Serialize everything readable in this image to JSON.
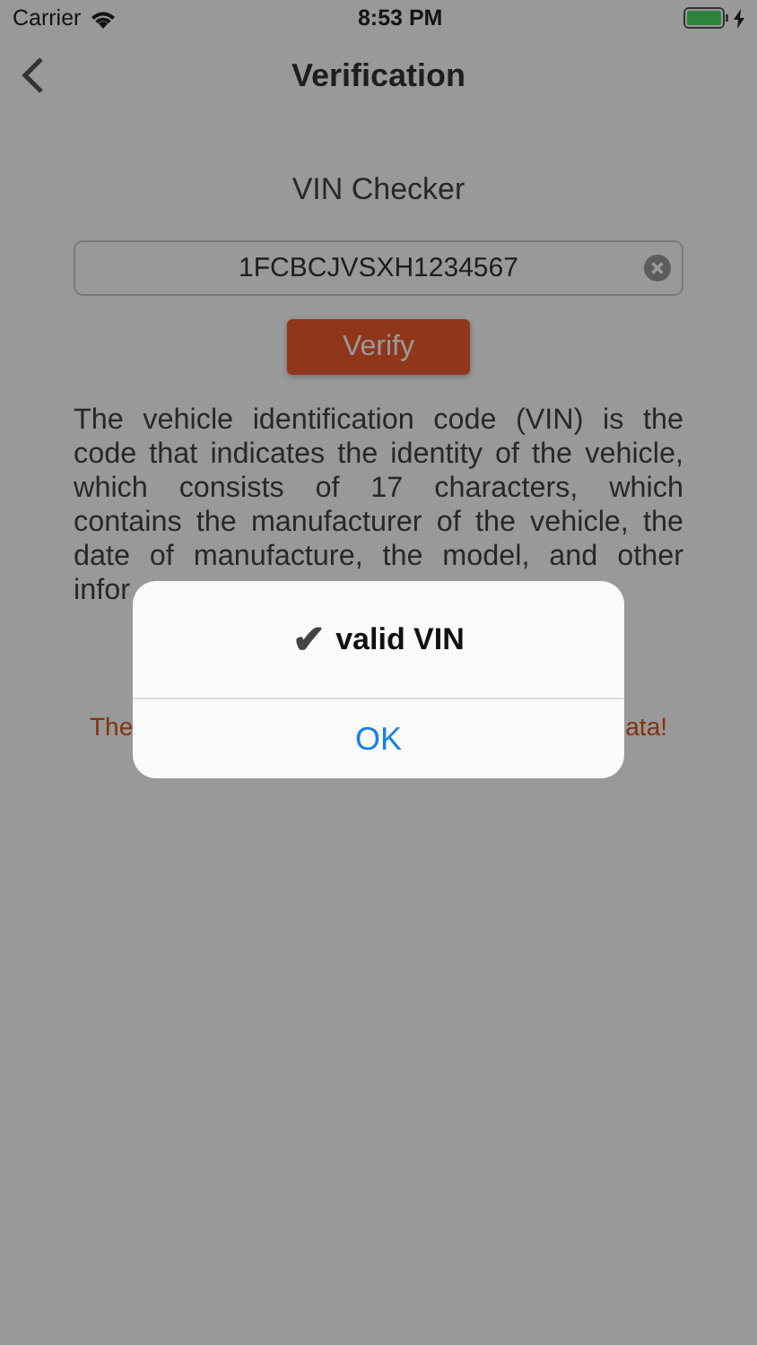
{
  "status_bar": {
    "carrier": "Carrier",
    "time": "8:53 PM"
  },
  "nav": {
    "title": "Verification"
  },
  "heading": "VIN Checker",
  "vin_field": {
    "value": "1FCBCJVSXH1234567"
  },
  "verify_button": "Verify",
  "description_lines": [
    "The vehicle identification code (VIN) is the",
    "code that indicates the identity of the vehicle,",
    "which consists of 17 characters, which",
    "contains the manufacturer of the vehicle, the",
    "date of manufacture, the model, and other",
    "infor"
  ],
  "notice": {
    "left": "The",
    "right": "ata!"
  },
  "alert": {
    "symbol": "✔",
    "title": "valid VIN",
    "button": "OK"
  }
}
